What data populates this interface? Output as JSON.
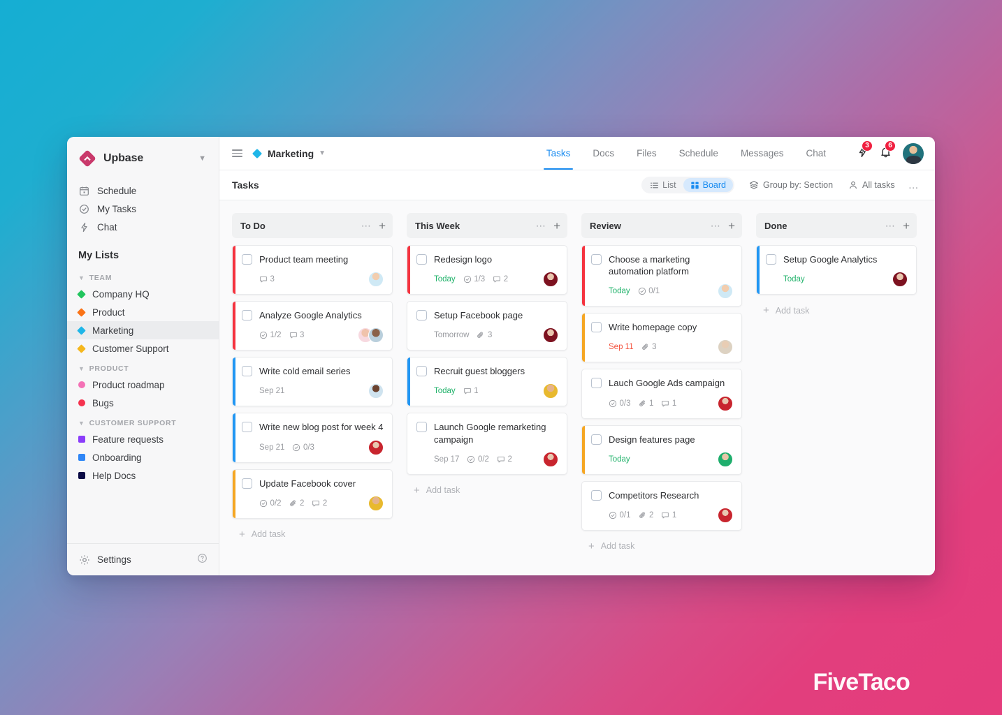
{
  "brand": {
    "name": "Upbase",
    "caret_icon": "chevron-down-icon",
    "logo_icon": "upbase-diamond-logo",
    "accent": "#c9396b"
  },
  "sidebar": {
    "nav": [
      {
        "label": "Schedule",
        "icon": "calendar-icon"
      },
      {
        "label": "My Tasks",
        "icon": "check-circle-icon"
      },
      {
        "label": "Chat",
        "icon": "lightning-icon"
      }
    ],
    "my_lists_title": "My Lists",
    "groups": [
      {
        "title": "TEAM",
        "items": [
          {
            "label": "Company HQ",
            "color": "#22c55e",
            "shape": "diamond",
            "active": false
          },
          {
            "label": "Product",
            "color": "#fa7317",
            "shape": "diamond",
            "active": false
          },
          {
            "label": "Marketing",
            "color": "#1fb6e8",
            "shape": "diamond",
            "active": true
          },
          {
            "label": "Customer Support",
            "color": "#f5b71d",
            "shape": "diamond",
            "active": false
          }
        ]
      },
      {
        "title": "PRODUCT",
        "items": [
          {
            "label": "Product roadmap",
            "color": "#f472b6",
            "shape": "round",
            "active": false
          },
          {
            "label": "Bugs",
            "color": "#f5334f",
            "shape": "round",
            "active": false
          }
        ]
      },
      {
        "title": "CUSTOMER SUPPORT",
        "items": [
          {
            "label": "Feature requests",
            "color": "#8b3dfa",
            "shape": "square",
            "active": false
          },
          {
            "label": "Onboarding",
            "color": "#2f86f6",
            "shape": "square",
            "active": false
          },
          {
            "label": "Help Docs",
            "color": "#0b0b45",
            "shape": "square",
            "active": false
          }
        ]
      }
    ],
    "footer": {
      "settings_label": "Settings",
      "settings_icon": "gear-icon",
      "help_icon": "question-circle-icon"
    }
  },
  "topbar": {
    "menu_icon": "hamburger-icon",
    "breadcrumb": {
      "label": "Marketing",
      "dot_color": "#1fb6e8",
      "caret_icon": "chevron-down-icon"
    },
    "tabs": [
      {
        "label": "Tasks",
        "active": true
      },
      {
        "label": "Docs",
        "active": false
      },
      {
        "label": "Files",
        "active": false
      },
      {
        "label": "Schedule",
        "active": false
      },
      {
        "label": "Messages",
        "active": false
      },
      {
        "label": "Chat",
        "active": false
      }
    ],
    "activity": {
      "icon": "lightning-icon",
      "count": "3"
    },
    "notifications": {
      "icon": "bell-icon",
      "count": "6"
    },
    "avatar": {
      "name": "user-avatar"
    },
    "active_tab_color": "#1a8cf0",
    "badge_color": "#f02040"
  },
  "toolbar": {
    "title": "Tasks",
    "views": [
      {
        "label": "List",
        "icon": "list-icon",
        "active": false
      },
      {
        "label": "Board",
        "icon": "board-icon",
        "active": true
      }
    ],
    "group_by": {
      "label": "Group by: Section",
      "icon": "layers-icon"
    },
    "filter": {
      "label": "All tasks",
      "icon": "person-icon"
    },
    "more": "…"
  },
  "board": {
    "add_task_label": "Add task",
    "columns": [
      {
        "title": "To Do",
        "cards": [
          {
            "title": "Product team meeting",
            "accent": "#f5333f",
            "due": "",
            "due_state": "",
            "meta": [
              {
                "icon": "comment-icon",
                "value": "3"
              }
            ],
            "avatars": [
              {
                "name": "avatar-red-shirt"
              }
            ]
          },
          {
            "title": "Analyze Google Analytics",
            "accent": "#f5333f",
            "due": "",
            "due_state": "",
            "meta": [
              {
                "icon": "subtask-icon",
                "value": "1/2"
              },
              {
                "icon": "comment-icon",
                "value": "3"
              }
            ],
            "avatars": [
              {
                "name": "avatar-pink"
              },
              {
                "name": "avatar-dark"
              }
            ]
          },
          {
            "title": "Write cold email series",
            "accent": "#2196f3",
            "due": "Sep 21",
            "due_state": "normal",
            "meta": [],
            "avatars": [
              {
                "name": "avatar-blue"
              }
            ]
          },
          {
            "title": "Write new blog post for week 4",
            "accent": "#2196f3",
            "due": "Sep 21",
            "due_state": "normal",
            "meta": [
              {
                "icon": "subtask-icon",
                "value": "0/3"
              }
            ],
            "avatars": [
              {
                "name": "avatar-crimson"
              }
            ]
          },
          {
            "title": "Update Facebook cover",
            "accent": "#f5a623",
            "due": "",
            "due_state": "",
            "meta": [
              {
                "icon": "subtask-icon",
                "value": "0/2"
              },
              {
                "icon": "attachment-icon",
                "value": "2"
              },
              {
                "icon": "comment-icon",
                "value": "2"
              }
            ],
            "avatars": [
              {
                "name": "avatar-yellow"
              }
            ]
          }
        ]
      },
      {
        "title": "This Week",
        "cards": [
          {
            "title": "Redesign logo",
            "accent": "#f5333f",
            "due": "Today",
            "due_state": "today",
            "meta": [
              {
                "icon": "subtask-icon",
                "value": "1/3"
              },
              {
                "icon": "comment-icon",
                "value": "2"
              }
            ],
            "avatars": [
              {
                "name": "avatar-maroon"
              }
            ]
          },
          {
            "title": "Setup Facebook page",
            "accent": "",
            "due": "Tomorrow",
            "due_state": "normal",
            "meta": [
              {
                "icon": "attachment-icon",
                "value": "3"
              }
            ],
            "avatars": [
              {
                "name": "avatar-maroon"
              }
            ]
          },
          {
            "title": "Recruit guest bloggers",
            "accent": "#2196f3",
            "due": "Today",
            "due_state": "today",
            "meta": [
              {
                "icon": "comment-icon",
                "value": "1"
              }
            ],
            "avatars": [
              {
                "name": "avatar-yellow"
              }
            ]
          },
          {
            "title": "Launch Google remarketing campaign",
            "accent": "",
            "due": "Sep 17",
            "due_state": "normal",
            "meta": [
              {
                "icon": "subtask-icon",
                "value": "0/2"
              },
              {
                "icon": "comment-icon",
                "value": "2"
              }
            ],
            "avatars": [
              {
                "name": "avatar-crimson"
              }
            ]
          }
        ]
      },
      {
        "title": "Review",
        "cards": [
          {
            "title": "Choose a marketing automation platform",
            "accent": "#f5333f",
            "due": "Today",
            "due_state": "today",
            "meta": [
              {
                "icon": "subtask-icon",
                "value": "0/1"
              }
            ],
            "avatars": [
              {
                "name": "avatar-red-shirt"
              }
            ]
          },
          {
            "title": "Write homepage copy",
            "accent": "#f5a623",
            "due": "Sep 11",
            "due_state": "overdue",
            "meta": [
              {
                "icon": "attachment-icon",
                "value": "3"
              }
            ],
            "avatars": [
              {
                "name": "avatar-beige"
              }
            ]
          },
          {
            "title": "Lauch Google Ads campaign",
            "accent": "",
            "due": "",
            "due_state": "",
            "meta": [
              {
                "icon": "subtask-icon",
                "value": "0/3"
              },
              {
                "icon": "attachment-icon",
                "value": "1"
              },
              {
                "icon": "comment-icon",
                "value": "1"
              }
            ],
            "avatars": [
              {
                "name": "avatar-crimson"
              }
            ]
          },
          {
            "title": "Design features page",
            "accent": "#f5a623",
            "due": "Today",
            "due_state": "today",
            "meta": [],
            "avatars": [
              {
                "name": "avatar-green"
              }
            ]
          },
          {
            "title": "Competitors Research",
            "accent": "",
            "due": "",
            "due_state": "",
            "meta": [
              {
                "icon": "subtask-icon",
                "value": "0/1"
              },
              {
                "icon": "attachment-icon",
                "value": "2"
              },
              {
                "icon": "comment-icon",
                "value": "1"
              }
            ],
            "avatars": [
              {
                "name": "avatar-crimson"
              }
            ]
          }
        ]
      },
      {
        "title": "Done",
        "cards": [
          {
            "title": "Setup Google Analytics",
            "accent": "#2196f3",
            "due": "Today",
            "due_state": "today",
            "meta": [],
            "avatars": [
              {
                "name": "avatar-maroon"
              }
            ]
          }
        ]
      }
    ]
  },
  "watermark": {
    "text": "FiveTaco"
  }
}
